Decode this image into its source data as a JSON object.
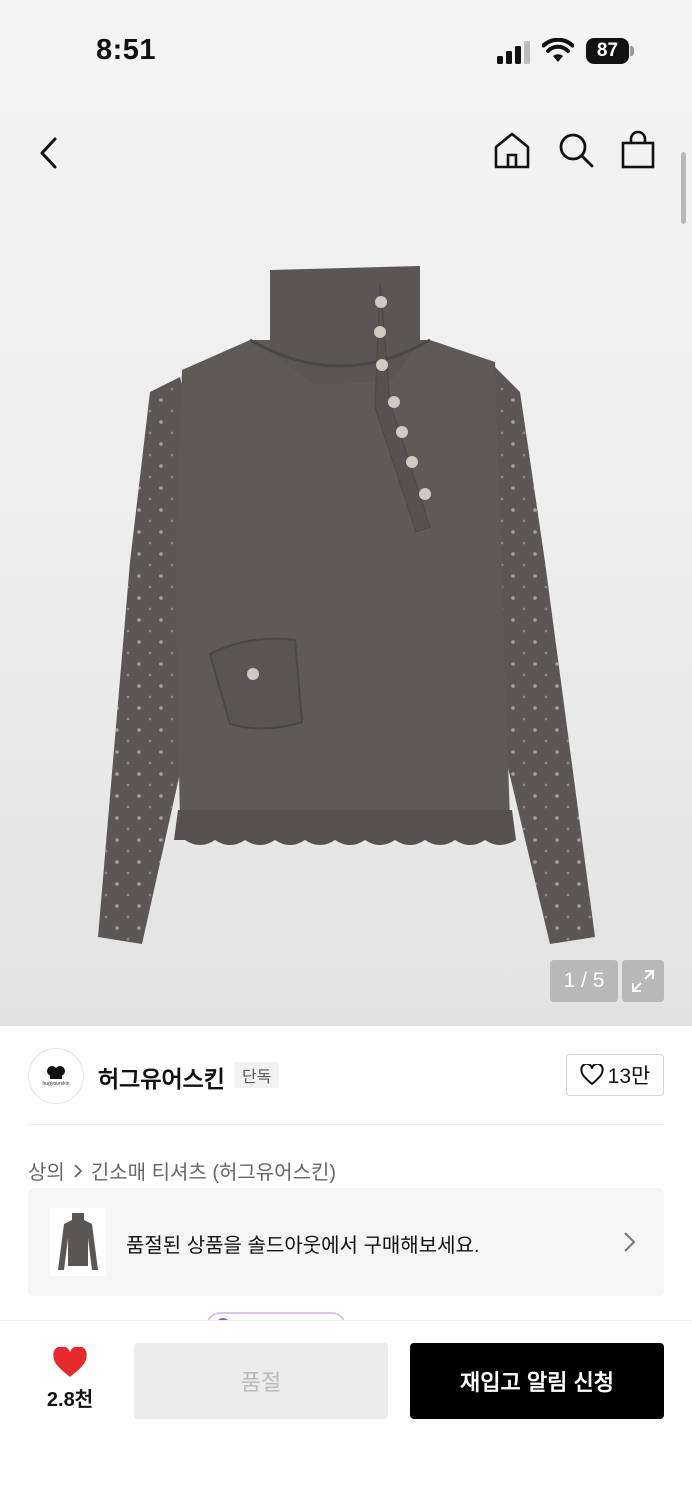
{
  "status_bar": {
    "time": "8:51",
    "battery": "87"
  },
  "nav": {
    "icons": [
      "chevron-left-icon",
      "home-icon",
      "search-icon",
      "shopping-bag-icon"
    ]
  },
  "gallery": {
    "pager": "1 / 5",
    "background": "#ececec"
  },
  "brand": {
    "name": "허그유어스킨",
    "exclusive_badge": "단독",
    "logo_text": "hugyourskin",
    "likes": "13만"
  },
  "breadcrumb": {
    "items": [
      "상의",
      "긴소매 티셔츠 (허그유어스킨)"
    ]
  },
  "soldout_banner": {
    "text": "품절된 상품을 솔드아웃에서 구매해보세요."
  },
  "bottom_bar": {
    "wish_count": "2.8천",
    "sold_out_label": "품절",
    "restock_label": "재입고 알림 신청",
    "heart_color": "#e8292c"
  }
}
